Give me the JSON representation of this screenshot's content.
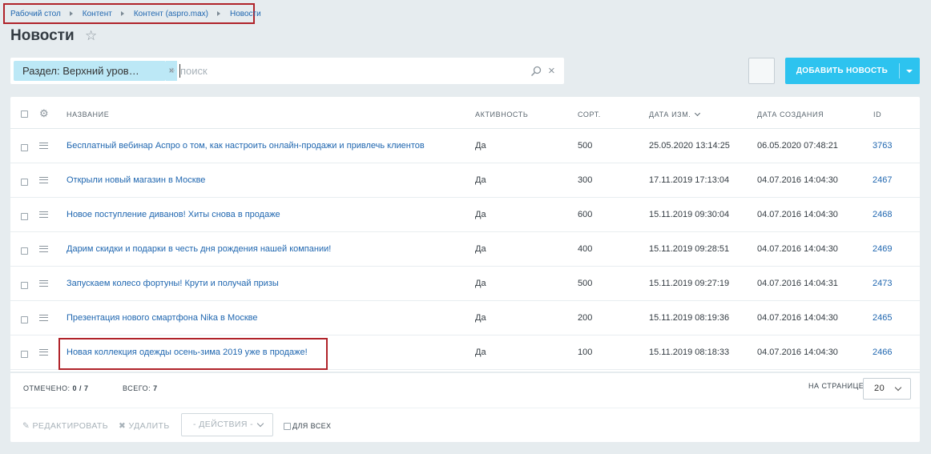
{
  "breadcrumb": [
    "Рабочий стол",
    "Контент",
    "Контент (aspro.max)",
    "Новости"
  ],
  "page": {
    "title": "Новости"
  },
  "filter": {
    "tag": "Раздел: Верхний уров…",
    "close": "×",
    "plus": "+",
    "placeholder": "поиск",
    "clear": "×"
  },
  "toolbar": {
    "add_label": "ДОБАВИТЬ НОВОСТЬ"
  },
  "grid": {
    "columns": {
      "name": "НАЗВАНИЕ",
      "active": "АКТИВНОСТЬ",
      "sort": "СОРТ.",
      "modified": "ДАТА ИЗМ.",
      "created": "ДАТА СОЗДАНИЯ",
      "id": "ID"
    },
    "rows": [
      {
        "name": "Бесплатный вебинар Аспро о том, как настроить онлайн-продажи и привлечь клиентов",
        "active": "Да",
        "sort": "500",
        "modified": "25.05.2020 13:14:25",
        "created": "06.05.2020 07:48:21",
        "id": "3763"
      },
      {
        "name": "Открыли новый магазин в Москве",
        "active": "Да",
        "sort": "300",
        "modified": "17.11.2019 17:13:04",
        "created": "04.07.2016 14:04:30",
        "id": "2467"
      },
      {
        "name": "Новое поступление диванов! Хиты снова в продаже",
        "active": "Да",
        "sort": "600",
        "modified": "15.11.2019 09:30:04",
        "created": "04.07.2016 14:04:30",
        "id": "2468"
      },
      {
        "name": "Дарим скидки и подарки в честь дня рождения нашей компании!",
        "active": "Да",
        "sort": "400",
        "modified": "15.11.2019 09:28:51",
        "created": "04.07.2016 14:04:30",
        "id": "2469"
      },
      {
        "name": "Запускаем колесо фортуны! Крути и получай призы",
        "active": "Да",
        "sort": "500",
        "modified": "15.11.2019 09:27:19",
        "created": "04.07.2016 14:04:31",
        "id": "2473"
      },
      {
        "name": "Презентация нового смартфона Nika в Москве",
        "active": "Да",
        "sort": "200",
        "modified": "15.11.2019 08:19:36",
        "created": "04.07.2016 14:04:30",
        "id": "2465"
      },
      {
        "name": "Новая коллекция одежды осень-зима 2019 уже в продаже!",
        "active": "Да",
        "sort": "100",
        "modified": "15.11.2019 08:18:33",
        "created": "04.07.2016 14:04:30",
        "id": "2466"
      }
    ]
  },
  "footer": {
    "selected_label": "ОТМЕЧЕНО:",
    "selected_value": "0 / 7",
    "total_label": "ВСЕГО:",
    "total_value": "7",
    "per_page_label": "НА СТРАНИЦЕ:",
    "per_page_value": "20"
  },
  "actions": {
    "edit": "РЕДАКТИРОВАТЬ",
    "delete": "УДАЛИТЬ",
    "select": "- ДЕЙСТВИЯ -",
    "for_all": "ДЛЯ ВСЕХ"
  }
}
